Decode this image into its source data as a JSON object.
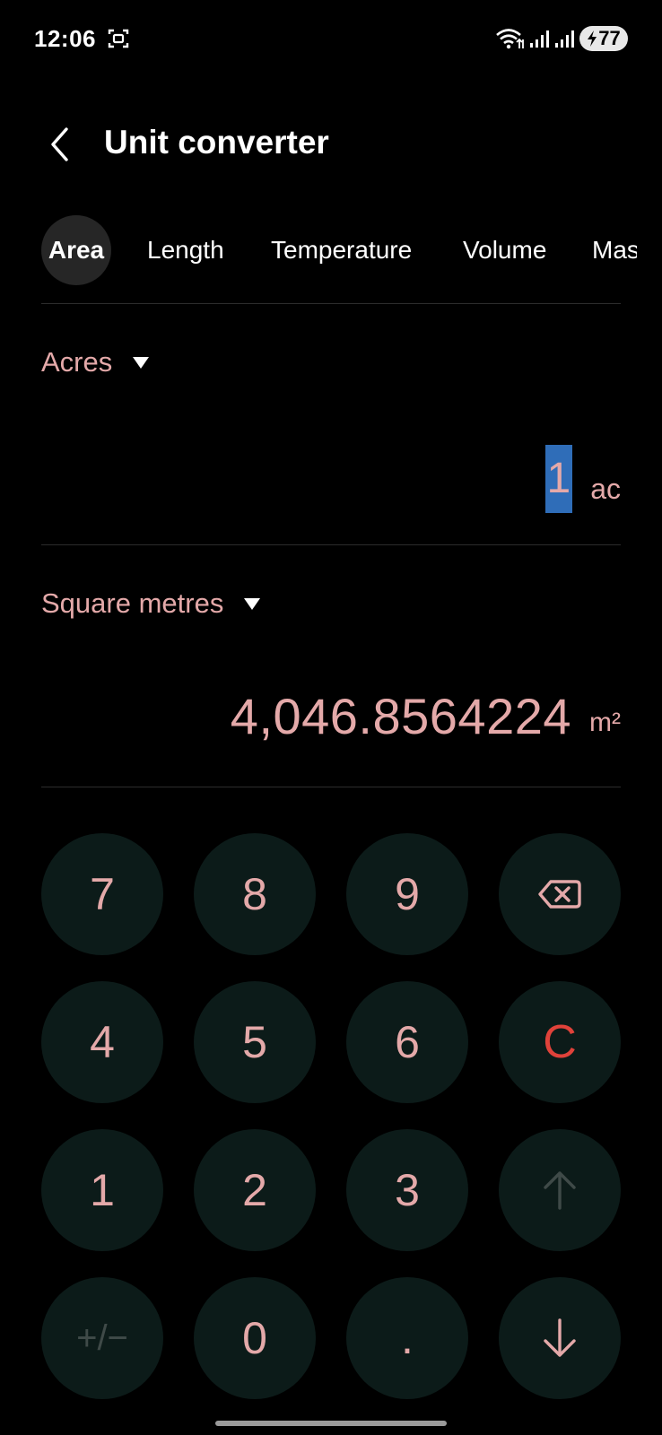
{
  "status_bar": {
    "time": "12:06",
    "battery": "77",
    "icons": [
      "screenshot-icon",
      "wifi-icon",
      "signal-icon",
      "signal-icon",
      "battery-charging-icon"
    ]
  },
  "header": {
    "title": "Unit converter",
    "back_icon": "chevron-left-icon"
  },
  "tabs": [
    {
      "label": "Area",
      "active": true
    },
    {
      "label": "Length",
      "active": false
    },
    {
      "label": "Temperature",
      "active": false
    },
    {
      "label": "Volume",
      "active": false
    },
    {
      "label": "Mass",
      "active": false
    }
  ],
  "converter": {
    "from": {
      "unit_name": "Acres",
      "value": "1",
      "unit_symbol": "ac"
    },
    "to": {
      "unit_name": "Square metres",
      "value": "4,046.8564224",
      "unit_symbol": "m²"
    }
  },
  "keypad": {
    "rows": [
      [
        "7",
        "8",
        "9",
        "backspace"
      ],
      [
        "4",
        "5",
        "6",
        "C"
      ],
      [
        "1",
        "2",
        "3",
        "up"
      ],
      [
        "+/−",
        "0",
        ".",
        "down"
      ]
    ],
    "labels": {
      "k7": "7",
      "k8": "8",
      "k9": "9",
      "k4": "4",
      "k5": "5",
      "k6": "6",
      "clear": "C",
      "k1": "1",
      "k2": "2",
      "k3": "3",
      "plusminus": "+/−",
      "k0": "0",
      "dot": "."
    },
    "icons": {
      "backspace": "backspace-icon",
      "up": "arrow-up-icon",
      "down": "arrow-down-icon"
    }
  },
  "colors": {
    "background": "#000000",
    "accent_text": "#e4a9a9",
    "key_background": "#0c1b19",
    "clear": "#e0423a",
    "disabled": "#3f4a48",
    "selection": "#2f6db8",
    "active_tab": "#262626"
  }
}
